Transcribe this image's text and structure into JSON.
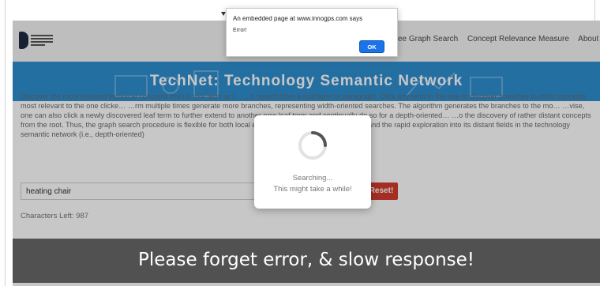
{
  "navbar": {
    "links": [
      "ee Graph Search",
      "Concept Relevance Measure",
      "About Us"
    ]
  },
  "hero": {
    "title": "TechNet: Technology Semantic Network"
  },
  "description": {
    "text": "Discover the most relevant technical concepts from a root term or t… …h search from a root term or paragraph. Click any term in the tree to discover branches to other concepts most relevant to the one clicke… …rm multiple times generate more branches, representing width-oriented searches. The algorithm generates the branches to the mo… …vise, one can also click a newly discovered leaf term to further extend to another new leaf term and continually do so for a depth-oriented… …o the discovery of rather distant concepts from the root. Thus, the graph search procedure is flexible for both local exploitation and dis… …e-oriented) and the rapid exploration into its distant fields in the technology semantic network (i.e., depth-oriented)"
  },
  "search": {
    "value": "heating chair",
    "reset_label": "Reset!",
    "chars_left": "Characters Left: 987"
  },
  "loading": {
    "line1": "Searching...",
    "line2": "This might take a while!"
  },
  "alert": {
    "title": "An embedded page at www.innogps.com says",
    "message": "Error!",
    "ok_label": "OK"
  },
  "caption": {
    "text": "Please forget error, & slow response!"
  },
  "colors": {
    "hero_bg": "#2f8fd0",
    "reset_bg": "#d23b2c",
    "ok_bg": "#1a73e8",
    "caption_bg": "#464646"
  }
}
